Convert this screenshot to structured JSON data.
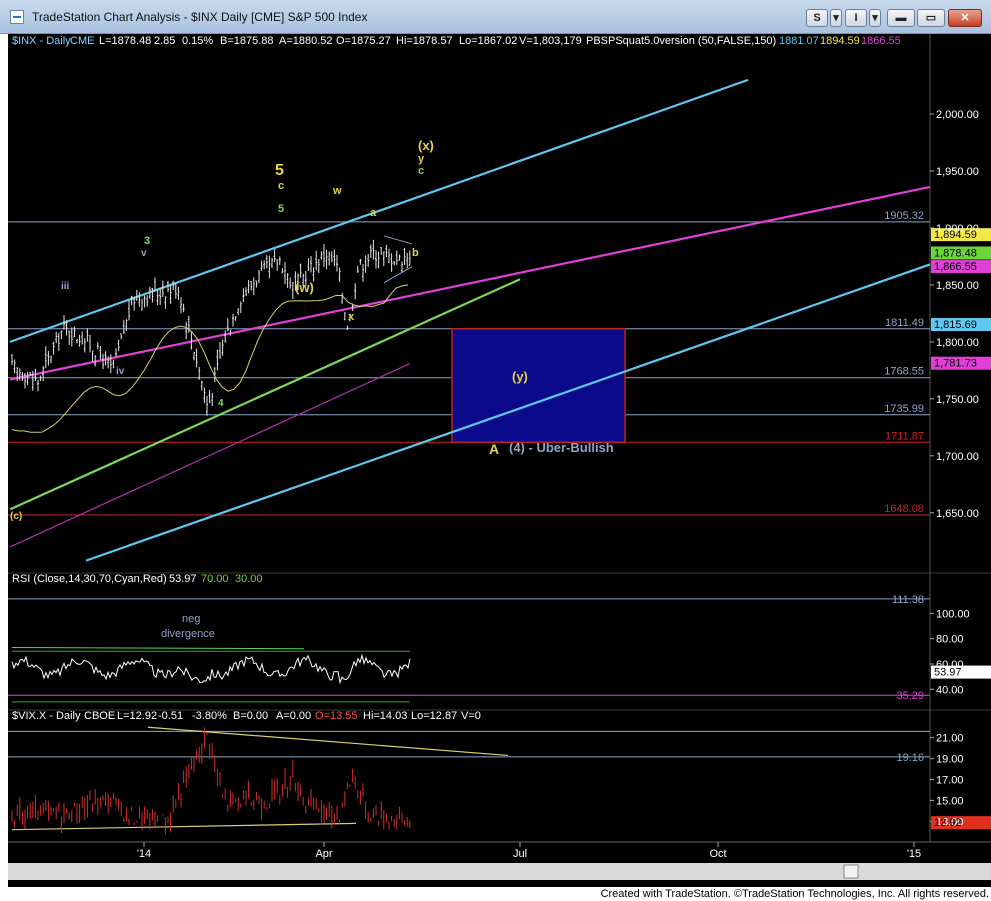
{
  "window": {
    "title": "TradeStation Chart Analysis - $INX Daily [CME] S&P 500 Index",
    "buttons": {
      "s": "S",
      "i": "I",
      "min": "▬",
      "max": "▭",
      "close": "✕"
    }
  },
  "header": {
    "symbol": "$INX - Daily",
    "exchange": "CME",
    "last": "L=1878.48",
    "change": "2.85",
    "pct": "0.15%",
    "bid": "B=1875.88",
    "ask": "A=1880.52",
    "open": "O=1875.27",
    "high": "Hi=1878.57",
    "low": "Lo=1867.02",
    "volume": "V=1,803,179",
    "indicator": "PBSPSquat5.0version (50,FALSE,150)",
    "ind1": "1881.07",
    "ind2": "1894.59",
    "ind3": "1866.55"
  },
  "rsi_header": {
    "name": "RSI (Close,14,30,70,Cyan,Red)",
    "value": "53.97",
    "ob": "70.00",
    "os": "30.00"
  },
  "vix_header": {
    "symbol": "$VIX.X - Daily",
    "exchange": "CBOE",
    "last": "L=12.92",
    "change": "-0.51",
    "pct": "-3.80%",
    "bid": "B=0.00",
    "ask": "A=0.00",
    "open": "O=13.55",
    "high": "Hi=14.03",
    "low": "Lo=12.87",
    "volume": "V=0"
  },
  "colors": {
    "background": "#000000",
    "cyan": "#5ec8f0",
    "magenta": "#e040d8",
    "green": "#7ed85a",
    "yellow": "#e6d34a",
    "red": "#d42020",
    "box": "#0a0a8a"
  },
  "chart_data": [
    {
      "type": "candlestick",
      "title": "$INX Daily [CME] S&P 500 Index",
      "x_ticks": [
        "'14",
        "Apr",
        "Jul",
        "Oct",
        "'15"
      ],
      "y_ticks": [
        2000,
        1950,
        1900,
        1850,
        1800,
        1750,
        1700,
        1650
      ],
      "y_tick_labels": [
        "2,000.00",
        "1,950.00",
        "1,900.00",
        "1,850.00",
        "1,800.00",
        "1,750.00",
        "1,700.00",
        "1,650.00"
      ],
      "ylim": [
        1598,
        2058
      ],
      "horizontal_levels": [
        {
          "value": 1905.32,
          "label": "1905.32",
          "color": "#8aa6c8"
        },
        {
          "value": 1811.49,
          "label": "1811.49",
          "color": "#8aa6c8"
        },
        {
          "value": 1768.55,
          "label": "1768.55",
          "color": "#8aa6c8"
        },
        {
          "value": 1735.99,
          "label": "1735.99",
          "color": "#8aa6c8"
        },
        {
          "value": 1711.87,
          "label": "1711.87",
          "color": "#d42020"
        },
        {
          "value": 1648.08,
          "label": "1648.08",
          "color": "#d42020"
        }
      ],
      "price_markers": [
        {
          "value": 1894.59,
          "label": "1,894.59",
          "color": "#f3e84a"
        },
        {
          "value": 1878.48,
          "label": "1,878.48",
          "color": "#6ad63a"
        },
        {
          "value": 1866.55,
          "label": "1,866.55",
          "color": "#e040d8"
        },
        {
          "value": 1815.69,
          "label": "1,815.69",
          "color": "#5ec8f0"
        },
        {
          "value": 1781.73,
          "label": "1,781.73",
          "color": "#e040d8"
        }
      ],
      "wave_labels": [
        {
          "text": "5",
          "color": "#e6d34a"
        },
        {
          "text": "c",
          "color": "#e6d34a"
        },
        {
          "text": "5",
          "color": "#7ed85a"
        },
        {
          "text": "w",
          "color": "#e6d34a"
        },
        {
          "text": "a",
          "color": "#e6d34a"
        },
        {
          "text": "(x)",
          "color": "#e6d34a"
        },
        {
          "text": "y",
          "color": "#e6d34a"
        },
        {
          "text": "c",
          "color": "#7ed85a"
        },
        {
          "text": "b",
          "color": "#e6d34a"
        },
        {
          "text": "(w)",
          "color": "#e6d34a"
        },
        {
          "text": "x",
          "color": "#e6d34a"
        },
        {
          "text": "3",
          "color": "#7ed85a"
        },
        {
          "text": "v",
          "color": "#8aa6c8"
        },
        {
          "text": "iii",
          "color": "#8aa6c8"
        },
        {
          "text": "iv",
          "color": "#8aa6c8"
        },
        {
          "text": "4",
          "color": "#7ed85a"
        },
        {
          "text": "(c)",
          "color": "#e6d34a"
        },
        {
          "text": "(y)",
          "color": "#e6d34a"
        },
        {
          "text": "A",
          "color": "#e6d34a"
        }
      ],
      "target_label": "(4) - Uber-Bullish"
    },
    {
      "type": "line",
      "title": "RSI (Close,14,30,70,Cyan,Red)",
      "y_ticks": [
        100,
        80,
        60,
        40
      ],
      "y_tick_labels": [
        "100.00",
        "80.00",
        "60.00",
        "40.00"
      ],
      "ylim": [
        26,
        120
      ],
      "levels": [
        {
          "value": 111.38,
          "label": "111.38"
        },
        {
          "value": 35.29,
          "label": "35.29"
        }
      ],
      "last": {
        "value": 53.97,
        "label": "53.97"
      },
      "annotation": [
        "neg",
        "divergence"
      ]
    },
    {
      "type": "bar",
      "title": "$VIX.X - Daily CBOE",
      "y_ticks": [
        21,
        19,
        17,
        15,
        13
      ],
      "y_tick_labels": [
        "21.00",
        "19.00",
        "17.00",
        "15.00",
        "13.00"
      ],
      "ylim": [
        11.5,
        22.5
      ],
      "levels": [
        {
          "value": 19.16,
          "label": "19.16"
        }
      ],
      "last": {
        "value": 12.92,
        "label": "12.92"
      }
    }
  ],
  "footer": "Created with TradeStation. ©TradeStation Technologies, Inc. All rights reserved."
}
